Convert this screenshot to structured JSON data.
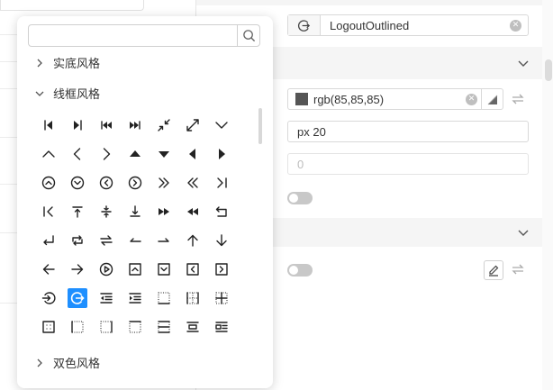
{
  "panel": {
    "icon_field": {
      "value": "LogoutOutlined"
    },
    "color_field": {
      "value": "rgb(85,85,85)",
      "swatch": "#555555"
    },
    "size_field": {
      "value": "px 20"
    },
    "number_field": {
      "placeholder": "0"
    }
  },
  "picker": {
    "search": {
      "placeholder": "",
      "value": ""
    },
    "groups": {
      "solid": "实底风格",
      "outline": "线框风格",
      "twotone": "双色风格"
    },
    "selected_icon": "logout-icon",
    "accent": "#1e8fff",
    "icons": [
      "step-backward-icon",
      "step-forward-icon",
      "fast-backward-icon",
      "fast-forward-icon",
      "shrink-icon",
      "arrows-alt-icon",
      "down-icon",
      "up-icon",
      "left-icon",
      "right-icon",
      "caret-up-icon",
      "caret-down-icon",
      "caret-left-icon",
      "caret-right-icon",
      "up-circle-icon",
      "down-circle-icon",
      "left-circle-icon",
      "right-circle-icon",
      "double-right-icon",
      "double-left-icon",
      "vertical-left-icon",
      "vertical-right-icon",
      "vertical-align-top-icon",
      "vertical-align-middle-icon",
      "vertical-align-bottom-icon",
      "forward-icon",
      "backward-icon",
      "rollback-icon",
      "enter-icon",
      "retweet-icon",
      "swap-icon",
      "swap-left-icon",
      "swap-right-icon",
      "arrow-up-icon",
      "arrow-down-icon",
      "arrow-left-icon",
      "arrow-right-icon",
      "play-circle-icon",
      "up-square-icon",
      "down-square-icon",
      "left-square-icon",
      "right-square-icon",
      "login-icon",
      "logout-icon",
      "menu-fold-icon",
      "menu-unfold-icon",
      "border-bottom-icon",
      "border-horizontal-icon",
      "border-inner-icon",
      "border-outer-icon",
      "border-left-icon",
      "border-right-icon",
      "border-top-icon",
      "border-verticle-icon",
      "pic-center-icon",
      "pic-left-icon"
    ]
  }
}
